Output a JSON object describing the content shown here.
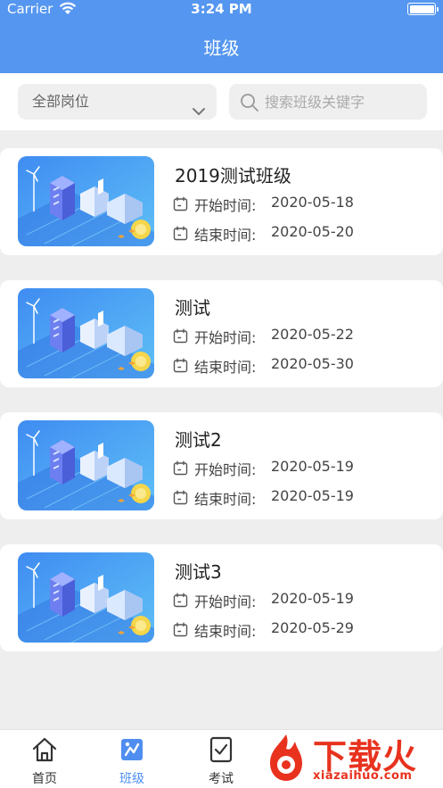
{
  "status_bar": {
    "carrier": "Carrier",
    "time": "3:24 PM"
  },
  "header": {
    "title": "班级"
  },
  "filter": {
    "position_select": "全部岗位",
    "search_placeholder": "搜索班级关键字"
  },
  "classes": [
    {
      "name": "2019测试班级",
      "start_label": "开始时间:",
      "start": "2020-05-18",
      "end_label": "结束时间:",
      "end": "2020-05-20"
    },
    {
      "name": "测试",
      "start_label": "开始时间:",
      "start": "2020-05-22",
      "end_label": "结束时间:",
      "end": "2020-05-30"
    },
    {
      "name": "测试2",
      "start_label": "开始时间:",
      "start": "2020-05-19",
      "end_label": "结束时间:",
      "end": "2020-05-19"
    },
    {
      "name": "测试3",
      "start_label": "开始时间:",
      "start": "2020-05-19",
      "end_label": "结束时间:",
      "end": "2020-05-29"
    }
  ],
  "tabbar": {
    "items": [
      {
        "label": "首页",
        "icon": "home-icon"
      },
      {
        "label": "班级",
        "icon": "class-icon",
        "active": true
      },
      {
        "label": "考试",
        "icon": "exam-icon"
      }
    ]
  },
  "watermark": {
    "text": "下载火",
    "url": "xiazaihuo.com"
  },
  "colors": {
    "primary": "#5596f0",
    "tab_active": "#4f8ef0",
    "watermark": "#e8321e"
  }
}
